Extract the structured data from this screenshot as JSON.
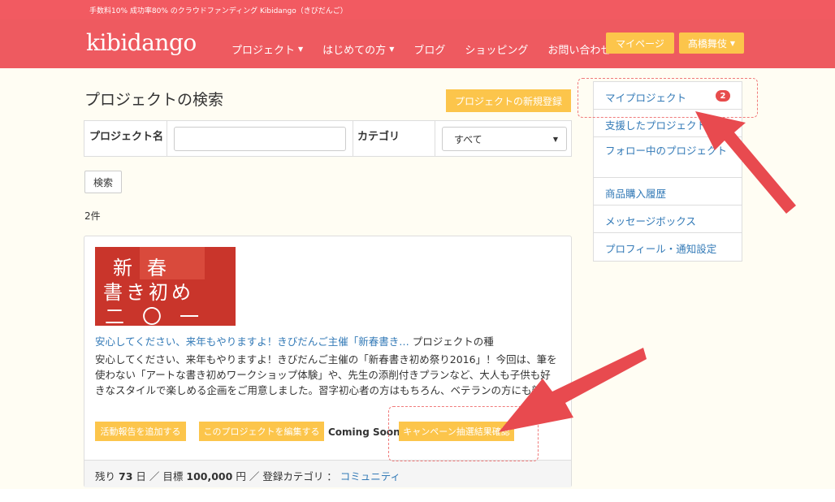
{
  "topbar": {
    "text": "手数料10% 成功率80% のクラウドファンディング Kibidango（きびだんご）"
  },
  "header": {
    "logo": "kibidango",
    "nav": [
      {
        "label": "プロジェクト",
        "has_caret": true
      },
      {
        "label": "はじめての方",
        "has_caret": true
      },
      {
        "label": "ブログ",
        "has_caret": false
      },
      {
        "label": "ショッピング",
        "has_caret": false
      },
      {
        "label": "お問い合わせ",
        "has_caret": false
      }
    ],
    "mypage_label": "マイページ",
    "user_label": "髙橋舞伎"
  },
  "main": {
    "title": "プロジェクトの検索",
    "new_project_label": "プロジェクトの新規登録",
    "search": {
      "name_label": "プロジェクト名",
      "name_value": "",
      "category_label": "カテゴリ",
      "category_value": "すべて",
      "button_label": "検索"
    },
    "result_count": "2件",
    "project": {
      "thumbnail_text": [
        "新春",
        "書き初め",
        "二〇一六"
      ],
      "title": "安心してください、来年もやりますよ！きびだんご主催「新春書き…",
      "title_tag": "プロジェクトの種",
      "description": "安心してください、来年もやりますよ！きびだんご主催の「新春書き初め祭り2016」！今回は、筆を使わない「アートな書き初めワークショップ体験」や、先生の添削付きプランなど、大人も子供も好きなスタイルで楽しめる企画をご用意しました。習字初心者の方はもちろん、ベテランの方にも新しい「書」",
      "buttons": {
        "add_report": "活動報告を追加する",
        "edit_project": "このプロジェクトを編集する",
        "coming_soon": "Coming Soon!",
        "campaign_result": "キャンペーン抽選結果確認"
      },
      "footer": {
        "remaining_prefix": "残り",
        "remaining_days": "73",
        "days_unit": "日",
        "sep1": "／",
        "goal_prefix": "目標",
        "goal_amount": "100,000",
        "goal_unit": "円",
        "sep2": "／",
        "category_prefix": "登録カテゴリ ：",
        "category_link": "コミュニティ"
      }
    }
  },
  "sidebar": {
    "items": [
      {
        "label": "マイプロジェクト",
        "badge": "2"
      },
      {
        "label": "支援したプロジェクト"
      },
      {
        "label": "フォロー中のプロジェクト"
      },
      {
        "label": "商品購入履歴"
      },
      {
        "label": "メッセージボックス"
      },
      {
        "label": "プロフィール・通知設定"
      }
    ]
  },
  "colors": {
    "header": "#ee5a60",
    "accent_button": "#fcc54b",
    "link": "#337ab7",
    "annotation_arrow": "#e84a4f"
  }
}
